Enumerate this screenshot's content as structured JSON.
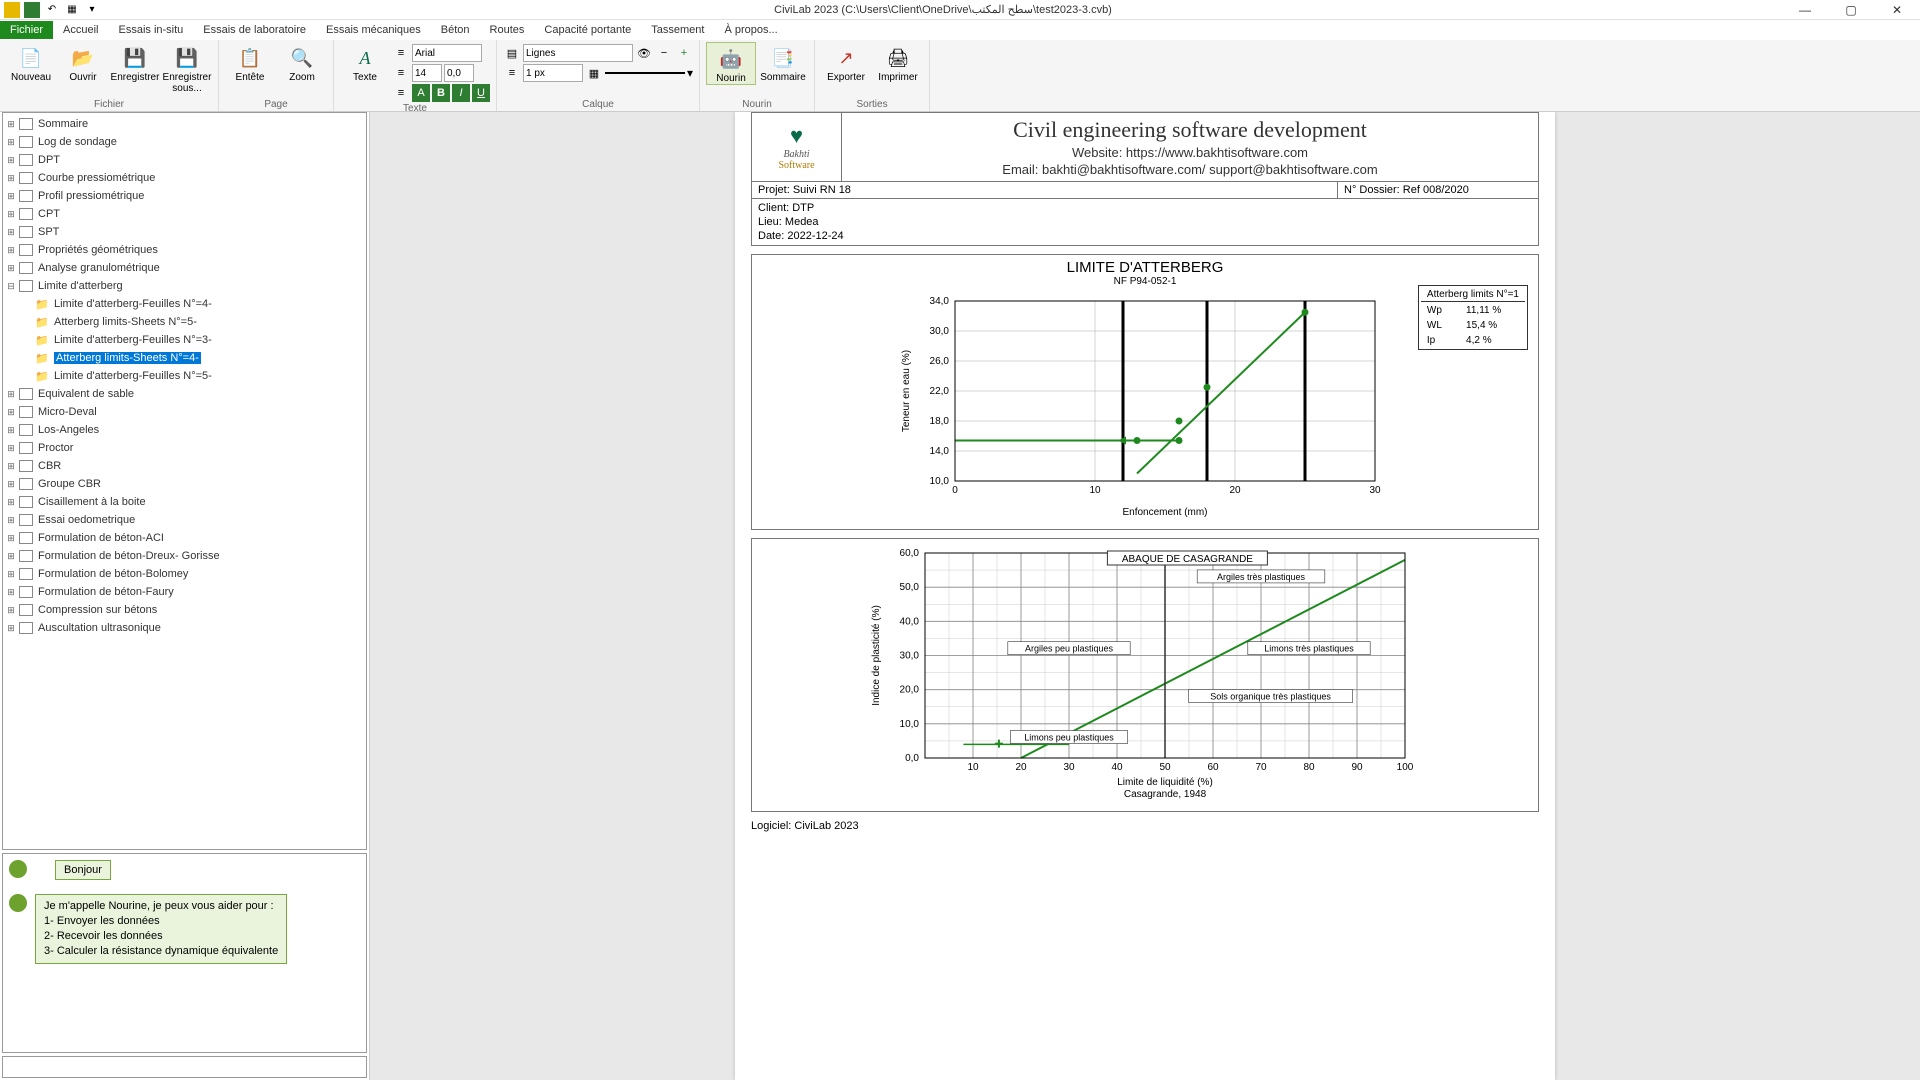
{
  "app_title": "CiviLab  2023 (C:\\Users\\Client\\OneDrive\\سطح المكتب\\test2023-3.cvb)",
  "qat": [
    "□",
    "■",
    "↶",
    "▦",
    "▾"
  ],
  "win": {
    "min": "—",
    "max": "▢",
    "close": "✕"
  },
  "tabs": [
    "Fichier",
    "Accueil",
    "Essais in-situ",
    "Essais de laboratoire",
    "Essais mécaniques",
    "Béton",
    "Routes",
    "Capacité portante",
    "Tassement",
    "À propos..."
  ],
  "ribbon": {
    "fichier": {
      "label": "Fichier",
      "nouveau": "Nouveau",
      "ouvrir": "Ouvrir",
      "enregistrer": "Enregistrer",
      "enregistrer_sous": "Enregistrer sous..."
    },
    "page": {
      "label": "Page",
      "entete": "Entête",
      "zoom": "Zoom"
    },
    "texte": {
      "label": "Texte",
      "texte": "Texte",
      "font": "Arial",
      "size": "14",
      "other": "0,0"
    },
    "calque": {
      "label": "Calque",
      "type": "Lignes",
      "px": "1 px"
    },
    "nourin": {
      "label": "Nourin",
      "nourin": "Nourin",
      "sommaire": "Sommaire"
    },
    "sorties": {
      "label": "Sorties",
      "exporter": "Exporter",
      "imprimer": "Imprimer"
    }
  },
  "tree": [
    {
      "label": "Sommaire"
    },
    {
      "label": "Log de sondage"
    },
    {
      "label": "DPT"
    },
    {
      "label": "Courbe pressiométrique"
    },
    {
      "label": "Profil pressiométrique"
    },
    {
      "label": "CPT"
    },
    {
      "label": "SPT"
    },
    {
      "label": "Propriétés géométriques"
    },
    {
      "label": "Analyse granulométrique"
    },
    {
      "label": "Limite d'atterberg",
      "expanded": true,
      "children": [
        {
          "label": "Limite d'atterberg-Feuilles N°=4-"
        },
        {
          "label": "Atterberg limits-Sheets N°=5-"
        },
        {
          "label": "Limite d'atterberg-Feuilles N°=3-"
        },
        {
          "label": "Atterberg limits-Sheets N°=4-",
          "selected": true
        },
        {
          "label": "Limite d'atterberg-Feuilles N°=5-"
        }
      ]
    },
    {
      "label": "Equivalent de sable"
    },
    {
      "label": "Micro-Deval"
    },
    {
      "label": "Los-Angeles"
    },
    {
      "label": "Proctor"
    },
    {
      "label": "CBR"
    },
    {
      "label": "Groupe CBR"
    },
    {
      "label": "Cisaillement à la boite"
    },
    {
      "label": "Essai oedometrique"
    },
    {
      "label": "Formulation de béton-ACI"
    },
    {
      "label": "Formulation de béton-Dreux- Gorisse"
    },
    {
      "label": "Formulation de béton-Bolomey"
    },
    {
      "label": "Formulation de béton-Faury"
    },
    {
      "label": "Compression sur bétons"
    },
    {
      "label": "Auscultation ultrasonique"
    }
  ],
  "assistant": {
    "hello": "Bonjour",
    "intro": "Je m'appelle Nourine, je peux vous aider pour :",
    "l1": "1- Envoyer les données",
    "l2": "2- Recevoir les données",
    "l3": "3- Calculer la résistance dynamique équivalente"
  },
  "doc": {
    "company": "Civil engineering software development",
    "website_label": "Website: https://www.bakhtisoftware.com",
    "email_label": "Email: bakhti@bakhtisoftware.com/ support@bakhtisoftware.com",
    "logo1": "Bakhti",
    "logo2": "Software",
    "projet": "Projet: Suivi RN 18",
    "dossier": "N° Dossier: Ref 008/2020",
    "client": "Client: DTP",
    "lieu": "Lieu: Medea",
    "date": "Date: 2022-12-24",
    "chart1_title": "LIMITE D'ATTERBERG",
    "chart1_sub": "NF P94-052-1",
    "chart2_title": "ABAQUE DE CASAGRANDE",
    "chart2_labels": {
      "atp": "Argiles très plastiques",
      "app": "Argiles peu plastiques",
      "ltp": "Limons très plastiques",
      "sotp": "Sols organique très plastiques",
      "lpp": "Limons peu plastiques"
    },
    "results_title": "Atterberg limits N°=1",
    "results": [
      [
        "Wp",
        "11,11 %"
      ],
      [
        "WL",
        "15,4 %"
      ],
      [
        "Ip",
        "4,2 %"
      ]
    ],
    "axis1_x": "Enfoncement (mm)",
    "axis1_y": "Teneur en eau (%)",
    "axis2_x": "Limite de liquidité (%)",
    "axis2_y": "Indice de plasticité (%)",
    "casagrande": "Casagrande, 1948",
    "footer": "Logiciel: CiviLab 2023"
  },
  "chart_data": [
    {
      "type": "scatter",
      "title": "LIMITE D'ATTERBERG",
      "xlabel": "Enfoncement (mm)",
      "ylabel": "Teneur en eau (%)",
      "xlim": [
        0,
        30
      ],
      "ylim": [
        10,
        34
      ],
      "x_ticks": [
        0,
        10,
        20,
        30
      ],
      "y_ticks": [
        10.0,
        14.0,
        18.0,
        22.0,
        26.0,
        30.0,
        34.0
      ],
      "ref_x": [
        12,
        18,
        25
      ],
      "ref_y": 15.4,
      "series": [
        {
          "name": "data",
          "x": [
            13,
            16,
            16,
            18,
            25
          ],
          "y": [
            15.4,
            18.0,
            15.4,
            22.5,
            32.5
          ]
        }
      ]
    },
    {
      "type": "line",
      "title": "ABAQUE DE CASAGRANDE",
      "xlabel": "Limite de liquidité (%)",
      "ylabel": "Indice de plasticité (%)",
      "xlim": [
        0,
        100
      ],
      "ylim": [
        0,
        60
      ],
      "x_ticks": [
        10,
        20,
        30,
        40,
        50,
        60,
        70,
        80,
        90,
        100
      ],
      "y_ticks": [
        0,
        10,
        20,
        30,
        40,
        50,
        60
      ],
      "a_line": {
        "x": [
          20,
          100
        ],
        "y": [
          0,
          58
        ]
      },
      "point": {
        "x": 15.4,
        "y": 4.2
      }
    }
  ]
}
